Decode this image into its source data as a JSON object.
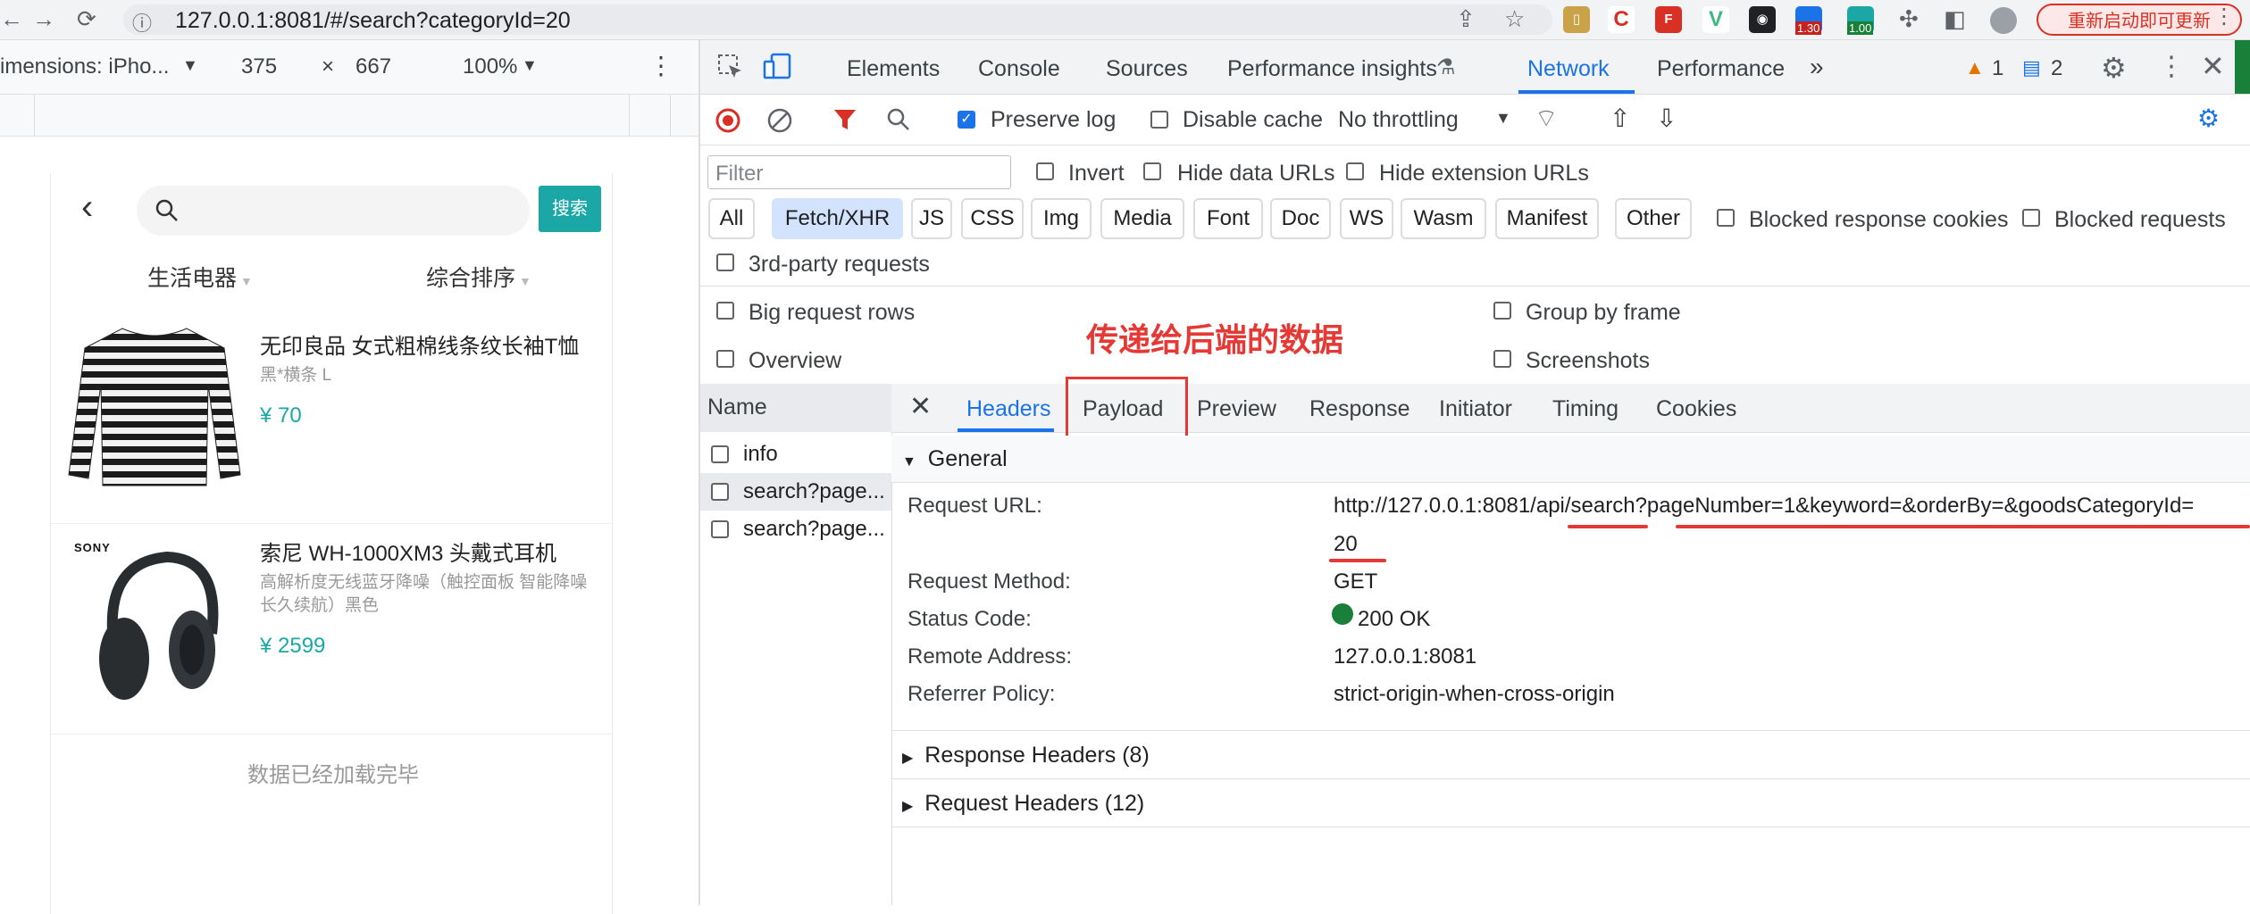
{
  "browser": {
    "url": "127.0.0.1:8081/#/search?categoryId=20",
    "restart_label": "重新启动即可更新",
    "ext_badge_1": "1.30",
    "ext_badge_2": "1.00"
  },
  "device_toolbar": {
    "dimensions_label": "imensions: iPho...",
    "width": "375",
    "times": "×",
    "height": "667",
    "zoom": "100%"
  },
  "phone": {
    "search_button": "搜索",
    "filters": [
      "生活电器",
      "综合排序"
    ],
    "products": [
      {
        "title": "无印良品 女式粗棉线条纹长袖T恤",
        "sub": "黑*横条 L",
        "price": "¥ 70"
      },
      {
        "title": "索尼 WH-1000XM3 头戴式耳机",
        "sub": "高解析度无线蓝牙降噪（触控面板 智能降噪 长久续航）黑色",
        "price": "¥ 2599",
        "brand": "SONY"
      }
    ],
    "footer": "数据已经加载完毕"
  },
  "devtools": {
    "tabs": [
      "Elements",
      "Console",
      "Sources",
      "Performance insights",
      "Network",
      "Performance"
    ],
    "warn_count": "1",
    "msg_count": "2",
    "toolbar": {
      "preserve_log": "Preserve log",
      "disable_cache": "Disable cache",
      "throttling": "No throttling"
    },
    "filter_placeholder": "Filter",
    "filter_opts": [
      "Invert",
      "Hide data URLs",
      "Hide extension URLs"
    ],
    "chips": [
      "All",
      "Fetch/XHR",
      "JS",
      "CSS",
      "Img",
      "Media",
      "Font",
      "Doc",
      "WS",
      "Wasm",
      "Manifest",
      "Other"
    ],
    "blocked_opts": [
      "Blocked response cookies",
      "Blocked requests"
    ],
    "third_party": "3rd-party requests",
    "settings_left": [
      "Big request rows",
      "Overview"
    ],
    "settings_right": [
      "Group by frame",
      "Screenshots"
    ],
    "annotation": "传递给后端的数据",
    "name_header": "Name",
    "requests": [
      "info",
      "search?page...",
      "search?page..."
    ],
    "detail_tabs": [
      "Headers",
      "Payload",
      "Preview",
      "Response",
      "Initiator",
      "Timing",
      "Cookies"
    ],
    "general_label": "General",
    "general": {
      "request_url_label": "Request URL:",
      "request_url": "http://127.0.0.1:8081/api/search?pageNumber=1&keyword=&orderBy=&goodsCategoryId=",
      "request_url_cont": "20",
      "method_label": "Request Method:",
      "method": "GET",
      "status_label": "Status Code:",
      "status": "200 OK",
      "remote_label": "Remote Address:",
      "remote": "127.0.0.1:8081",
      "referrer_label": "Referrer Policy:",
      "referrer": "strict-origin-when-cross-origin"
    },
    "response_headers": "Response Headers (8)",
    "request_headers": "Request Headers (12)",
    "colors": {
      "accent": "#1a73e8",
      "annotation": "#e53935",
      "status_ok": "#188038",
      "teal": "#1aa7a5"
    }
  }
}
